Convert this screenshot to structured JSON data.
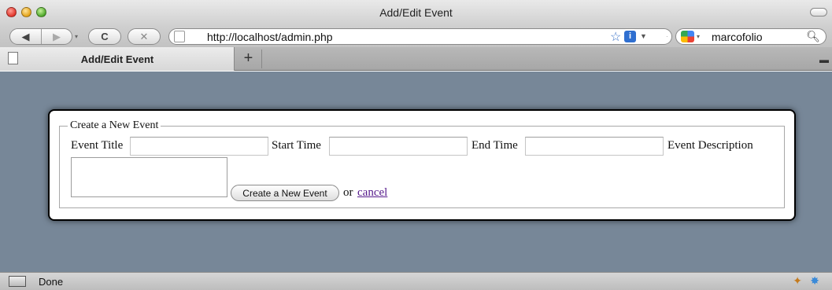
{
  "window": {
    "title": "Add/Edit Event"
  },
  "toolbar": {
    "back_glyph": "◀",
    "forward_glyph": "▶",
    "reload_glyph": "C",
    "stop_glyph": "✕",
    "url": "http://localhost/admin.php",
    "search_value": "marcofolio"
  },
  "tabs": [
    {
      "label": "Add/Edit Event"
    }
  ],
  "newtab_glyph": "+",
  "form": {
    "legend": "Create a New Event",
    "event_title_label": "Event Title",
    "event_title_value": "",
    "start_time_label": "Start Time",
    "start_time_value": "",
    "end_time_label": "End Time",
    "end_time_value": "",
    "event_description_label": "Event Description",
    "event_description_value": "",
    "submit_label": "Create a New Event",
    "or_text": "or",
    "cancel_label": "cancel"
  },
  "status": {
    "text": "Done"
  },
  "colors": {
    "page_background": "#778798",
    "visited_link": "#551a8b"
  }
}
